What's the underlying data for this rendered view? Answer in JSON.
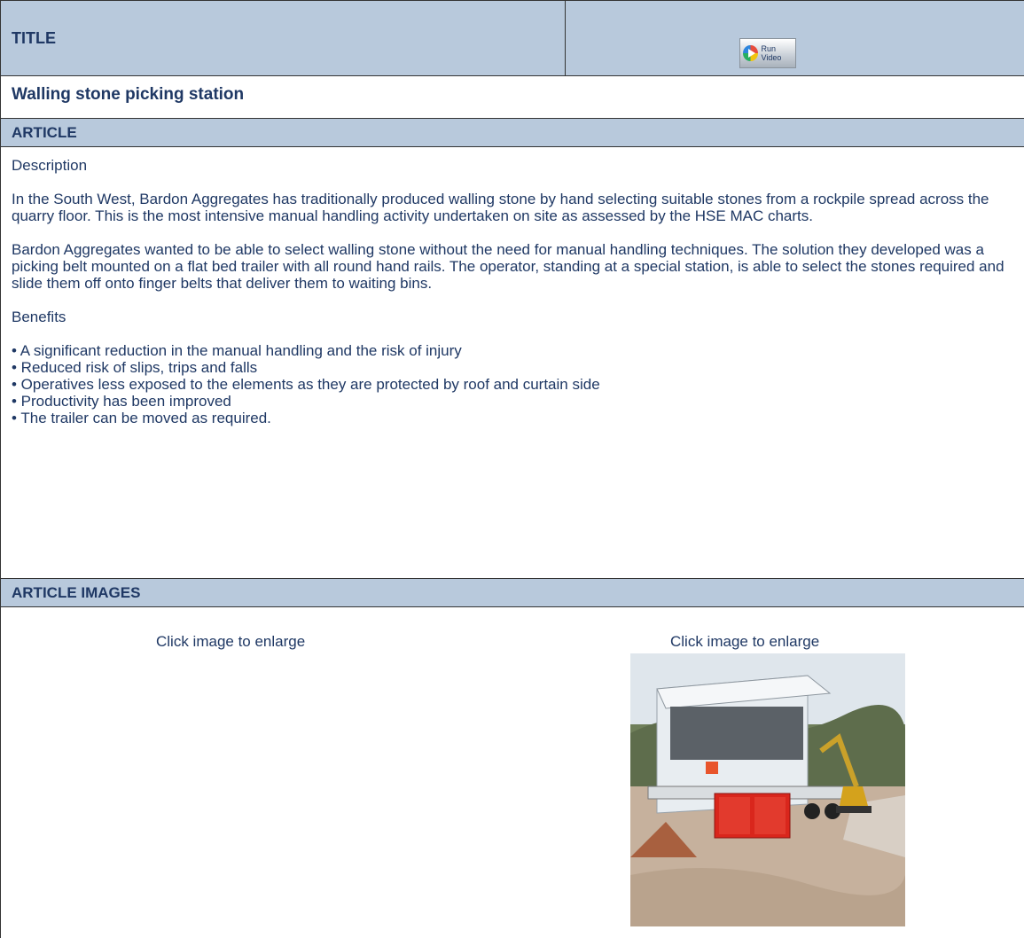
{
  "header": {
    "title_label": "TITLE",
    "video_button": {
      "label": "Run Video",
      "icon": "play-icon"
    }
  },
  "article_title": "Walling stone picking station",
  "sections": {
    "article": "ARTICLE",
    "article_images": "ARTICLE IMAGES"
  },
  "article": {
    "description_heading": "Description",
    "paragraph1": "In the South West, Bardon Aggregates has traditionally produced walling stone by hand selecting suitable stones from a rockpile spread across the quarry floor. This is the most intensive manual handling activity undertaken on site as assessed by the HSE MAC charts.",
    "paragraph2": "Bardon Aggregates wanted to be able to select walling stone without the need for manual handling techniques. The solution they developed was a picking belt mounted on a flat bed trailer with all round hand rails. The operator, standing at a special station, is able to select the stones required and slide them off onto finger belts that deliver them to waiting bins.",
    "benefits_heading": "Benefits",
    "benefits": [
      "• A significant reduction in the manual handling and the risk of injury",
      "• Reduced risk of slips, trips and falls",
      "• Operatives less exposed to the elements as they are protected by roof and curtain side",
      "• Productivity has been improved",
      "• The trailer can be moved as required."
    ]
  },
  "images": {
    "caption_left": "Click image to enlarge",
    "caption_right": "Click image to enlarge"
  },
  "colors": {
    "header_bg": "#b8c9dc",
    "text": "#1f3864"
  }
}
